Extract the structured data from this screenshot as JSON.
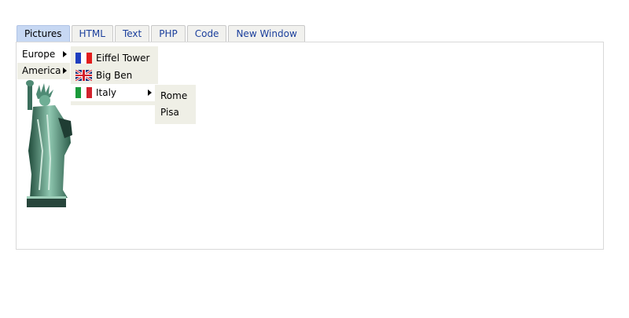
{
  "tabs": [
    {
      "label": "Pictures",
      "active": true
    },
    {
      "label": "HTML"
    },
    {
      "label": "Text"
    },
    {
      "label": "PHP"
    },
    {
      "label": "Code"
    },
    {
      "label": "New Window"
    }
  ],
  "menu_main": {
    "items": [
      {
        "label": "Europe",
        "has_submenu": true
      },
      {
        "label": "America",
        "has_submenu": true
      }
    ]
  },
  "menu_europe": {
    "items": [
      {
        "label": "Eiffel Tower",
        "icon": "france-flag-icon"
      },
      {
        "label": "Big Ben",
        "icon": "uk-flag-icon"
      },
      {
        "label": "Italy",
        "icon": "italy-flag-icon",
        "has_submenu": true
      }
    ]
  },
  "menu_italy": {
    "items": [
      {
        "label": "Rome"
      },
      {
        "label": "Pisa"
      }
    ]
  },
  "colors": {
    "active_tab": "#c7d8f3",
    "tab_text": "#1b3f9c",
    "menu_bg": "#efefe6"
  }
}
